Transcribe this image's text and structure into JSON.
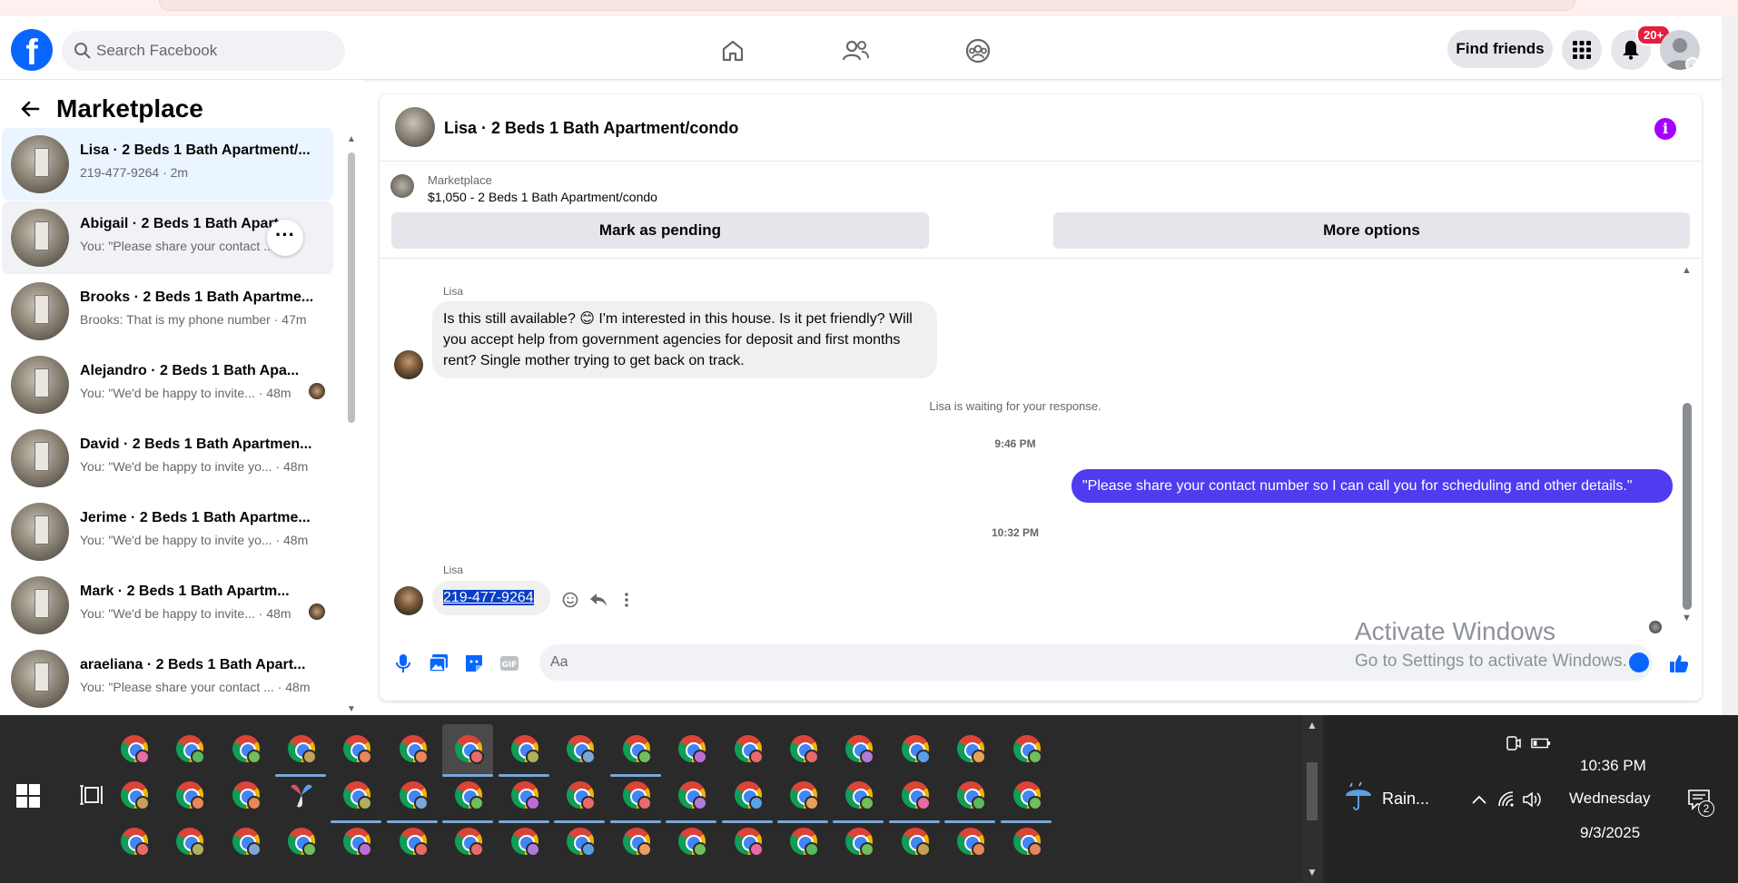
{
  "header": {
    "search_placeholder": "Search Facebook",
    "find_friends": "Find friends",
    "notif_count": "20+"
  },
  "sidebar": {
    "title": "Marketplace",
    "conversations": [
      {
        "name": "Lisa · 2 Beds 1 Bath Apartment/...",
        "sub": "219-477-9264 · 2m"
      },
      {
        "name": "Abigail · 2 Beds 1 Bath Apart...",
        "sub": "You: \"Please share your contact ... 2m"
      },
      {
        "name": "Brooks · 2 Beds 1 Bath Apartme...",
        "sub": "Brooks: That is my phone number · 47m"
      },
      {
        "name": "Alejandro · 2 Beds 1 Bath Apa...",
        "sub": "You: \"We'd be happy to invite... · 48m"
      },
      {
        "name": "David · 2 Beds 1 Bath Apartmen...",
        "sub": "You: \"We'd be happy to invite yo... · 48m"
      },
      {
        "name": "Jerime · 2 Beds 1 Bath Apartme...",
        "sub": "You: \"We'd be happy to invite yo... · 48m"
      },
      {
        "name": "Mark · 2 Beds 1 Bath Apartm...",
        "sub": "You: \"We'd be happy to invite... · 48m"
      },
      {
        "name": "araeliana · 2 Beds 1 Bath Apart...",
        "sub": "You: \"Please share your contact ... · 48m"
      }
    ]
  },
  "chat": {
    "title": "Lisa · 2 Beds 1 Bath Apartment/condo",
    "listing_label": "Marketplace",
    "listing_price": "$1,050 - 2 Beds 1 Bath Apartment/condo",
    "mark_pending": "Mark as pending",
    "more_options": "More options",
    "sender1": "Lisa",
    "msg1": "Is this still available? 😊 I'm interested in this house. Is it pet friendly? Will you accept help from government agencies for deposit and first months rent? Single mother trying to get back on track.",
    "waiting": "Lisa is waiting for your response.",
    "time1": "9:46 PM",
    "msg_out": "\"Please share your contact number so I can call you for scheduling and other details.\"",
    "time2": "10:32 PM",
    "sender2": "Lisa",
    "msg2": "219-477-9264",
    "composer_placeholder": "Aa"
  },
  "watermark": {
    "line1": "Activate Windows",
    "line2": "Go to Settings to activate Windows."
  },
  "taskbar": {
    "weather": "Rain...",
    "time": "10:36 PM",
    "day": "Wednesday",
    "date": "9/3/2025",
    "notification_count": "2"
  },
  "colors": {
    "facebook_blue": "#0866ff",
    "outgoing_bubble": "#4f3bf0",
    "info_purple": "#a400ff"
  }
}
